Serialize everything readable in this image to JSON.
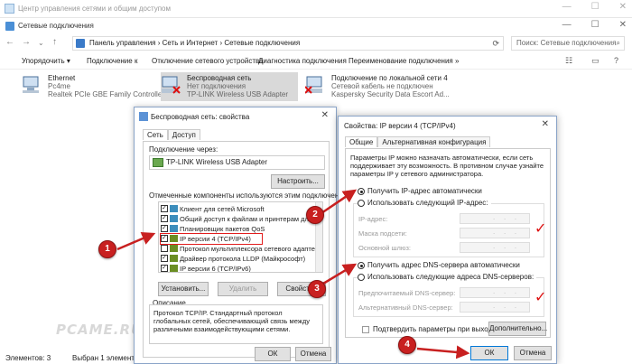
{
  "main_window": {
    "outer_title": "Центр управления сетями и общим доступом",
    "title": "Сетевые подключения",
    "breadcrumb": "Панель управления  ›  Сеть и Интернет  ›  Сетевые подключения",
    "search_placeholder": "Поиск: Сетевые подключения"
  },
  "toolbar": {
    "organize": "Упорядочить ▾",
    "connect": "Подключение к",
    "disable": "Отключение сетевого устройства",
    "diagnose": "Диагностика подключения",
    "rename": "Переименование подключения",
    "more": "»"
  },
  "adapters": [
    {
      "name": "Ethernet",
      "status": "Pc4me",
      "device": "Realtek PCIe GBE Family Controller"
    },
    {
      "name": "Беспроводная сеть",
      "status": "Нет подключения",
      "device": "TP-LINK Wireless USB Adapter"
    },
    {
      "name": "Подключение по локальной сети 4",
      "status": "Сетевой кабель не подключен",
      "device": "Kaspersky Security Data Escort Ad..."
    }
  ],
  "statusbar": {
    "count": "Элементов: 3",
    "selected": "Выбран 1 элемент"
  },
  "props_dialog": {
    "title": "Беспроводная сеть: свойства",
    "tab_network": "Сеть",
    "tab_access": "Доступ",
    "connect_via_label": "Подключение через:",
    "adapter": "TP-LINK Wireless USB Adapter",
    "configure": "Настроить...",
    "components_label": "Отмеченные компоненты используются этим подключением:",
    "components": [
      "Клиент для сетей Microsoft",
      "Общий доступ к файлам и принтерам для сетей",
      "Планировщик пакетов QoS",
      "IP версии 4 (TCP/IPv4)",
      "Протокол мультиплексора сетевого адаптера (Ма",
      "Драйвер протокола LLDP (Майкрософт)",
      "IP версии 6 (TCP/IPv6)"
    ],
    "install": "Установить...",
    "remove": "Удалить",
    "properties": "Свойства",
    "description_label": "Описание",
    "description": "Протокол TCP/IP. Стандартный протокол глобальных сетей, обеспечивающий связь между различными взаимодействующими сетями.",
    "ok": "ОК",
    "cancel": "Отмена"
  },
  "ipv4_dialog": {
    "title": "Свойства: IP версии 4 (TCP/IPv4)",
    "tab_general": "Общие",
    "tab_alt": "Альтернативная конфигурация",
    "intro": "Параметры IP можно назначать автоматически, если сеть поддерживает эту возможность. В противном случае узнайте параметры IP у сетевого администратора.",
    "auto_ip": "Получить IP-адрес автоматически",
    "manual_ip": "Использовать следующий IP-адрес:",
    "ip_address": "IP-адрес:",
    "subnet_mask": "Маска подсети:",
    "gateway": "Основной шлюз:",
    "auto_dns": "Получить адрес DNS-сервера автоматически",
    "manual_dns": "Использовать следующие адреса DNS-серверов:",
    "preferred_dns": "Предпочитаемый DNS-сервер:",
    "alternate_dns": "Альтернативный DNS-сервер:",
    "validate": "Подтвердить параметры при выходе",
    "advanced": "Дополнительно...",
    "ok": "ОК",
    "cancel": "Отмена"
  },
  "annotations": {
    "m1": "1",
    "m2": "2",
    "m3": "3",
    "m4": "4",
    "watermark": "PCAME.RU",
    "arrow_color": "#c82020"
  }
}
